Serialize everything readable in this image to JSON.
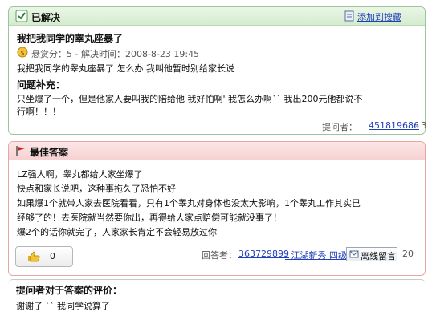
{
  "question": {
    "status": "已解决",
    "add_favorite": "添加到搜藏",
    "title": "我把我同学的睾丸座暴了",
    "meta": "悬赏分：5 - 解决时间：2008-8-23 19:45",
    "detail": "我把我同学的睾丸座暴了 怎么办 我叫他暂时别给家长说",
    "supplement_title": "问题补充：",
    "supplement_lines": [
      "只坐爆了一个，但是他家人要叫我的陪给他    我好怕啊' 我怎么办啊`` 我出200元他都说不",
      "行啊！！！"
    ],
    "asker_label": "提问者：",
    "asker_link": "451819686",
    "asker_suffix": "- 3"
  },
  "answer": {
    "header": "最佳答案",
    "lines": [
      "LZ强人啊，睾丸都给人家坐爆了",
      "快点和家长说吧，这种事拖久了恐怕不好",
      "如果爆1个就带人家去医院看看，只有1个睾丸对身体也没太大影响，1个睾丸工作其实已",
      "经够了的！去医院就当然要你出，再得给人家点赔偿可能就没事了！",
      "爆2个的话你就完了，人家家长肯定不会轻易放过你"
    ],
    "like_count": "0",
    "answerer_label": "回答者：",
    "answerer_link": "363729899",
    "answerer_title": "- 江湖新秀 四级",
    "message_button": "离线留言",
    "answerer_suffix": "20"
  },
  "evaluation": {
    "title": "提问者对于答案的评价：",
    "text": "谢谢了 `` 我同学说算了"
  },
  "colors": {
    "question_border": "#9cc59c",
    "answer_border": "#e7a6a6",
    "link": "#1f3fb8",
    "flag": "#cc2020"
  }
}
